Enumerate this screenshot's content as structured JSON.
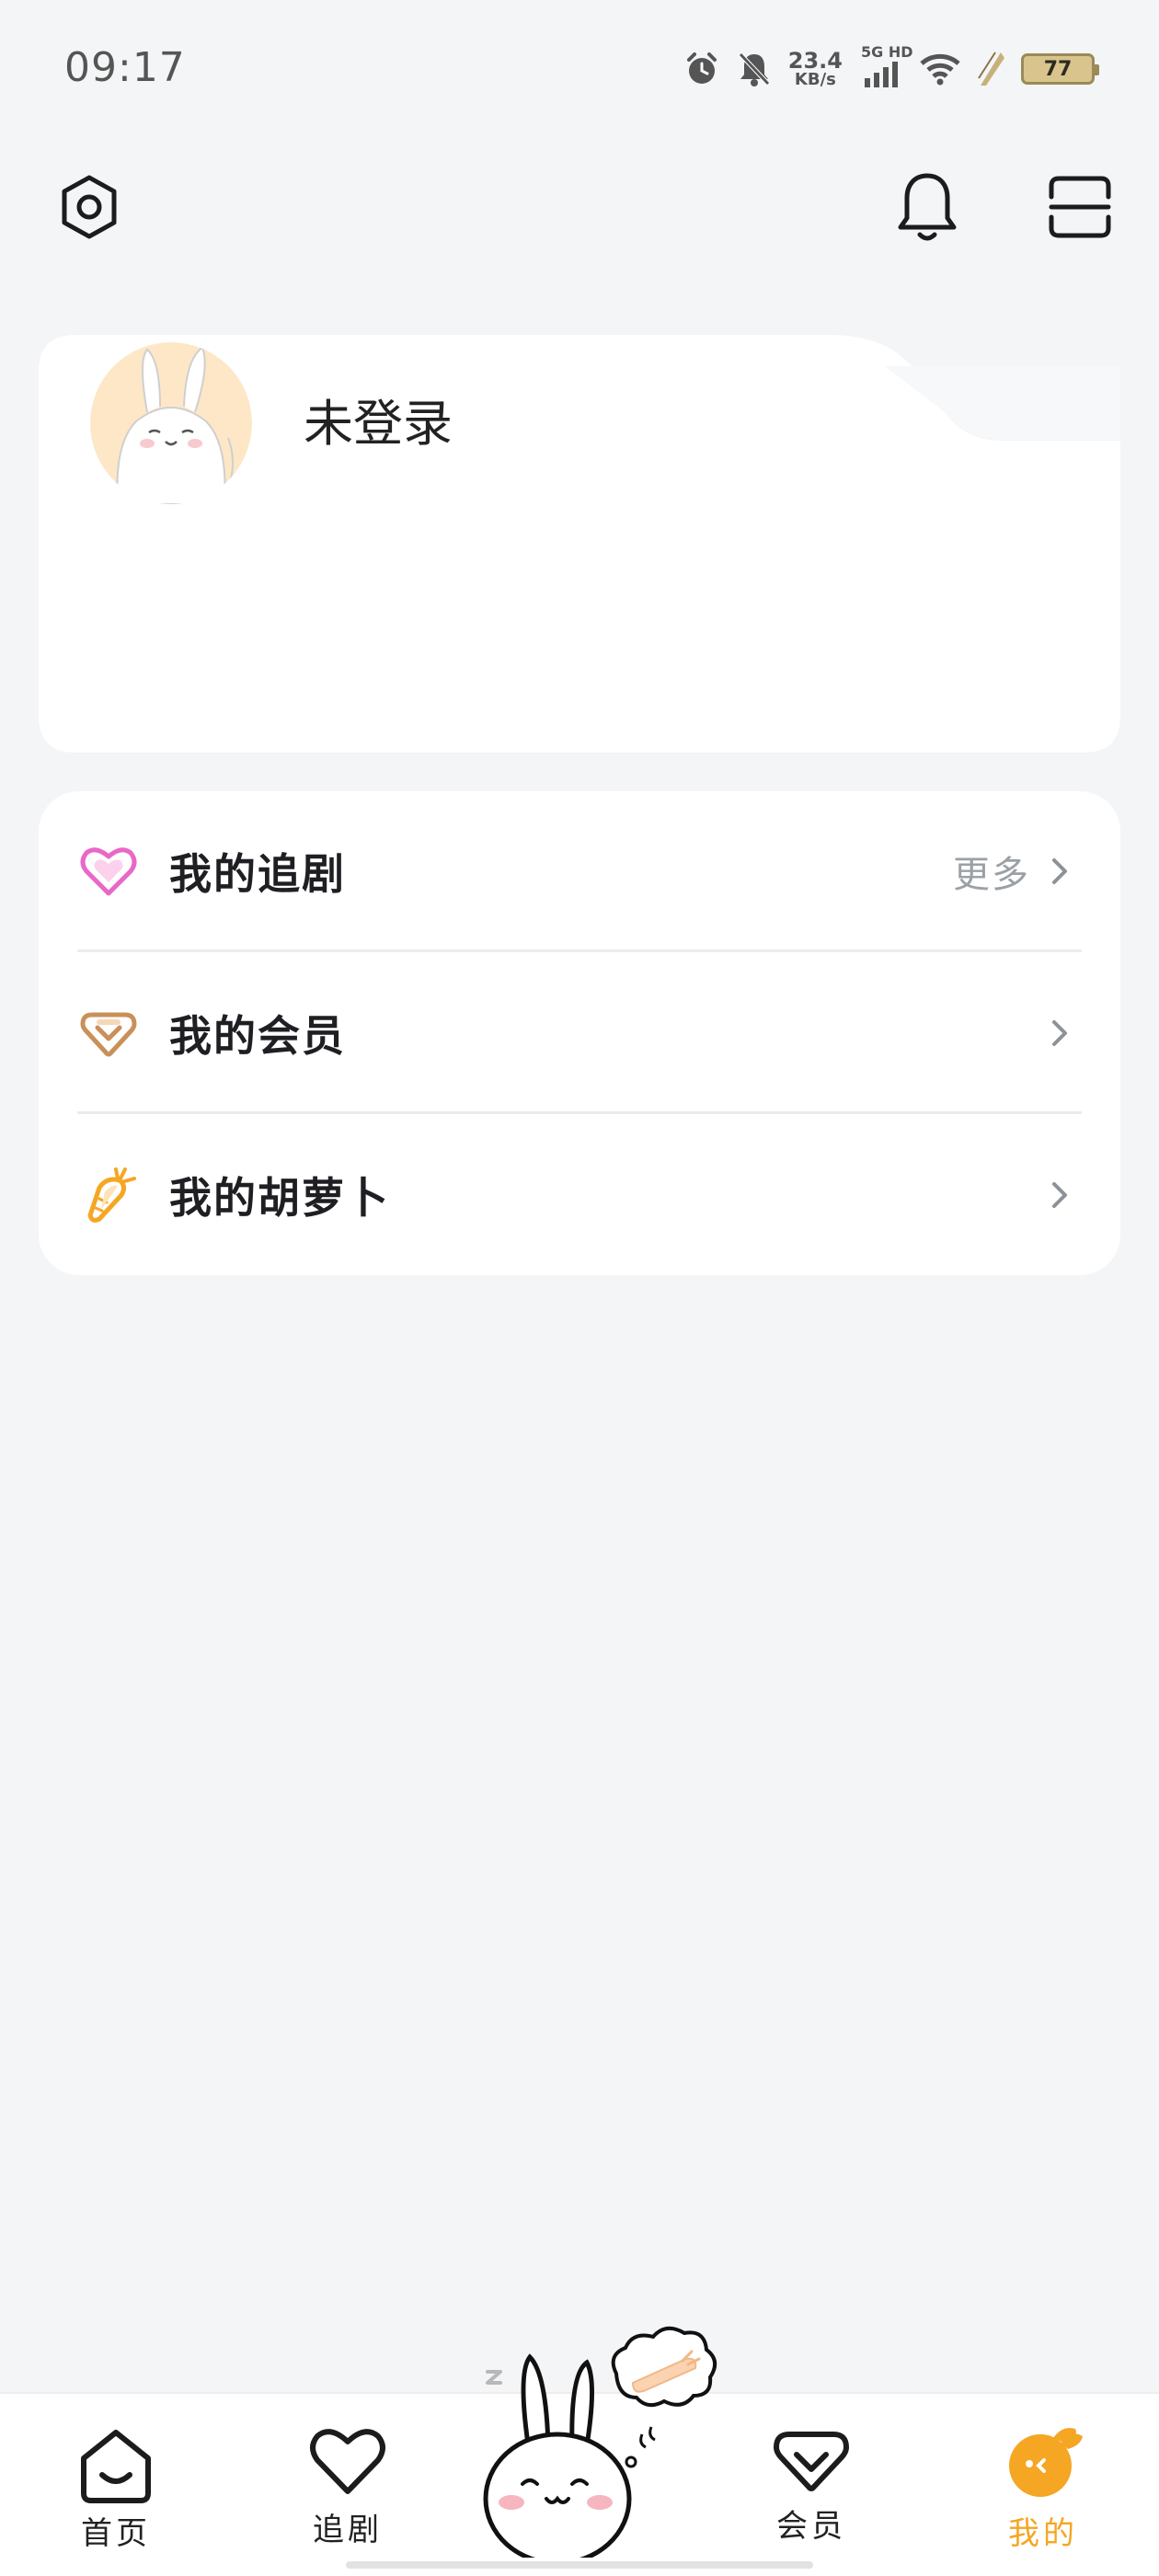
{
  "status_bar": {
    "time": "09:17",
    "net_speed_value": "23.4",
    "net_speed_unit": "KB/s",
    "network_tag": "5G HD",
    "battery": "77",
    "icons": [
      "alarm-icon",
      "mute-icon",
      "signal-icon",
      "wifi-icon",
      "charging-icon",
      "battery-icon"
    ]
  },
  "top_bar": {
    "icons": [
      "settings-icon",
      "bell-icon",
      "scan-icon"
    ]
  },
  "profile": {
    "status": "未登录"
  },
  "menu": {
    "items": [
      {
        "label": "我的追剧",
        "icon": "heart-icon",
        "icon_color": "#e868c8",
        "more": "更多"
      },
      {
        "label": "我的会员",
        "icon": "vip-diamond-icon",
        "icon_color": "#c9905a"
      },
      {
        "label": "我的胡萝卜",
        "icon": "carrot-icon",
        "icon_color": "#f5a623"
      }
    ]
  },
  "bottom_nav": {
    "items": [
      {
        "label": "首页",
        "icon": "home-icon"
      },
      {
        "label": "追剧",
        "icon": "heart-icon"
      },
      {
        "label": "会员",
        "icon": "vip-icon"
      },
      {
        "label": "我的",
        "icon": "profile-bunny-icon",
        "active": true
      }
    ],
    "mascot": "sleeping-bunny-icon"
  },
  "colors": {
    "background": "#f4f5f7",
    "card": "#ffffff",
    "accent": "#f5a623",
    "text": "#1f1f23",
    "muted": "#9aa0a6"
  }
}
